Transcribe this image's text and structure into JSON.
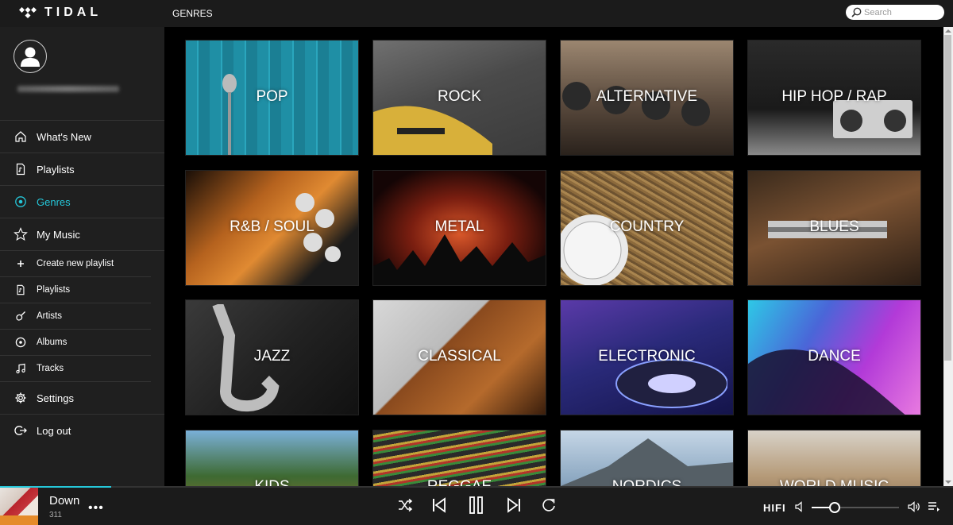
{
  "app": {
    "name": "TIDAL"
  },
  "header": {
    "section_title": "GENRES",
    "search_placeholder": "Search"
  },
  "sidebar": {
    "nav": [
      {
        "label": "What's New",
        "icon": "home-icon",
        "active": false
      },
      {
        "label": "Playlists",
        "icon": "document-icon",
        "active": false
      },
      {
        "label": "Genres",
        "icon": "target-icon",
        "active": true
      },
      {
        "label": "My Music",
        "icon": "star-icon",
        "active": false
      }
    ],
    "sub": [
      {
        "label": "Create new playlist",
        "icon": "plus-icon"
      },
      {
        "label": "Playlists",
        "icon": "document-icon"
      },
      {
        "label": "Artists",
        "icon": "guitar-icon"
      },
      {
        "label": "Albums",
        "icon": "disc-icon"
      },
      {
        "label": "Tracks",
        "icon": "note-icon"
      }
    ],
    "footer": [
      {
        "label": "Settings",
        "icon": "gear-icon"
      },
      {
        "label": "Log out",
        "icon": "logout-icon"
      }
    ]
  },
  "genres": [
    {
      "label": "POP"
    },
    {
      "label": "ROCK"
    },
    {
      "label": "ALTERNATIVE"
    },
    {
      "label": "HIP HOP / RAP"
    },
    {
      "label": "R&B / SOUL"
    },
    {
      "label": "METAL"
    },
    {
      "label": "COUNTRY"
    },
    {
      "label": "BLUES"
    },
    {
      "label": "JAZZ"
    },
    {
      "label": "CLASSICAL"
    },
    {
      "label": "ELECTRONIC"
    },
    {
      "label": "DANCE"
    },
    {
      "label": "KIDS"
    },
    {
      "label": "REGGAE"
    },
    {
      "label": "NORDICS"
    },
    {
      "label": "WORLD MUSIC"
    }
  ],
  "player": {
    "title": "Down",
    "subtitle": "311",
    "more_label": "•••",
    "quality": "HIFI",
    "progress": 0.117,
    "volume": 0.25
  },
  "colors": {
    "accent": "#25c7d9",
    "background": "#000000",
    "panel": "#1f1f1f"
  }
}
